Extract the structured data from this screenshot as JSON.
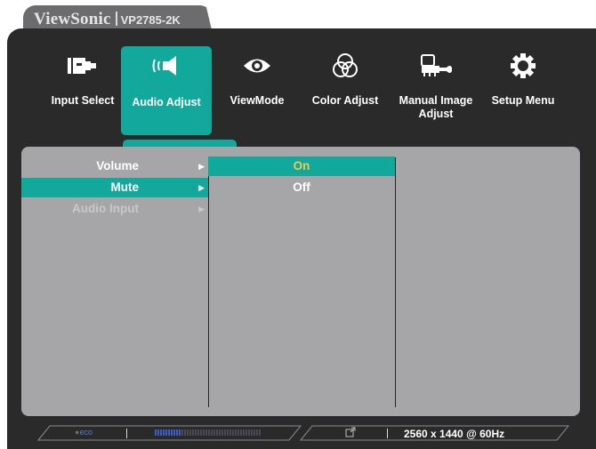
{
  "brand": {
    "logo": "ViewSonic",
    "model": "VP2785-2K"
  },
  "top_menu": [
    {
      "label": "Input Select",
      "icon": "input-select-icon"
    },
    {
      "label": "Audio Adjust",
      "icon": "audio-adjust-icon",
      "active": true
    },
    {
      "label": "ViewMode",
      "icon": "viewmode-eye-icon"
    },
    {
      "label": "Color Adjust",
      "icon": "color-adjust-icon"
    },
    {
      "label": "Manual Image Adjust",
      "icon": "manual-image-adjust-icon"
    },
    {
      "label": "Setup Menu",
      "icon": "setup-menu-gear-icon"
    }
  ],
  "submenu": [
    {
      "label": "Volume",
      "state": "normal"
    },
    {
      "label": "Mute",
      "state": "selected"
    },
    {
      "label": "Audio Input",
      "state": "disabled"
    }
  ],
  "options": [
    {
      "label": "On",
      "state": "selected"
    },
    {
      "label": "Off",
      "state": "normal"
    }
  ],
  "status_bar": {
    "eco_label": "eco",
    "resolution": "2560 x 1440 @ 60Hz",
    "brightness_level": 0.25
  },
  "colors": {
    "accent": "#12a89c",
    "option_selected_text": "#f2c94c",
    "panel": "#a6a6a8",
    "osd_background": "#2a2a2b"
  }
}
